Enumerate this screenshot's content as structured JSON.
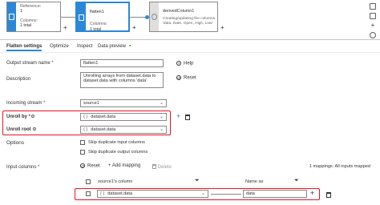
{
  "graph": {
    "nodes": [
      {
        "title": "Reference:",
        "line2": "1",
        "columns_label": "Columns:",
        "columns_value": "1 total"
      },
      {
        "title": "flatten1",
        "columns_label": "Columns:",
        "columns_value": "1 total"
      },
      {
        "title": "derivedColumn1",
        "desc": "Creating/updating the columns 'data, Date, Open, High, Low'"
      }
    ],
    "plus": "+"
  },
  "tabs": [
    {
      "label": "Flatten settings",
      "active": true
    },
    {
      "label": "Optimize"
    },
    {
      "label": "Inspect"
    },
    {
      "label": "Data preview",
      "badge": "●"
    }
  ],
  "form": {
    "output_stream_label": "Output stream name",
    "output_stream_value": "flatten1",
    "help_label": "Help",
    "description_label": "Description",
    "description_value": "Unrolling arrays from dataset.data to dataset.data with columns 'data'",
    "reset_label": "Reset",
    "incoming_stream_label": "Incoming stream",
    "incoming_stream_value": "source1",
    "unroll_by_label": "Unroll by",
    "unroll_by_value": "dataset.data",
    "unroll_root_label": "Unroll root",
    "unroll_root_value": "dataset.data",
    "expr_glyph": "{ }",
    "required_mark": "*",
    "options_label": "Options",
    "skip_dup_input": "Skip duplicate input columns",
    "skip_dup_output": "Skip duplicate output columns",
    "input_columns_label": "Input columns",
    "reset_btn": "Reset",
    "add_mapping": "Add mapping",
    "delete": "Delete",
    "mapping_count": "1 mappings: All inputs mapped",
    "col_source": "source1's column",
    "col_name_as": "Name as",
    "row_source_value": "dataset.data",
    "row_name_value": "data"
  }
}
